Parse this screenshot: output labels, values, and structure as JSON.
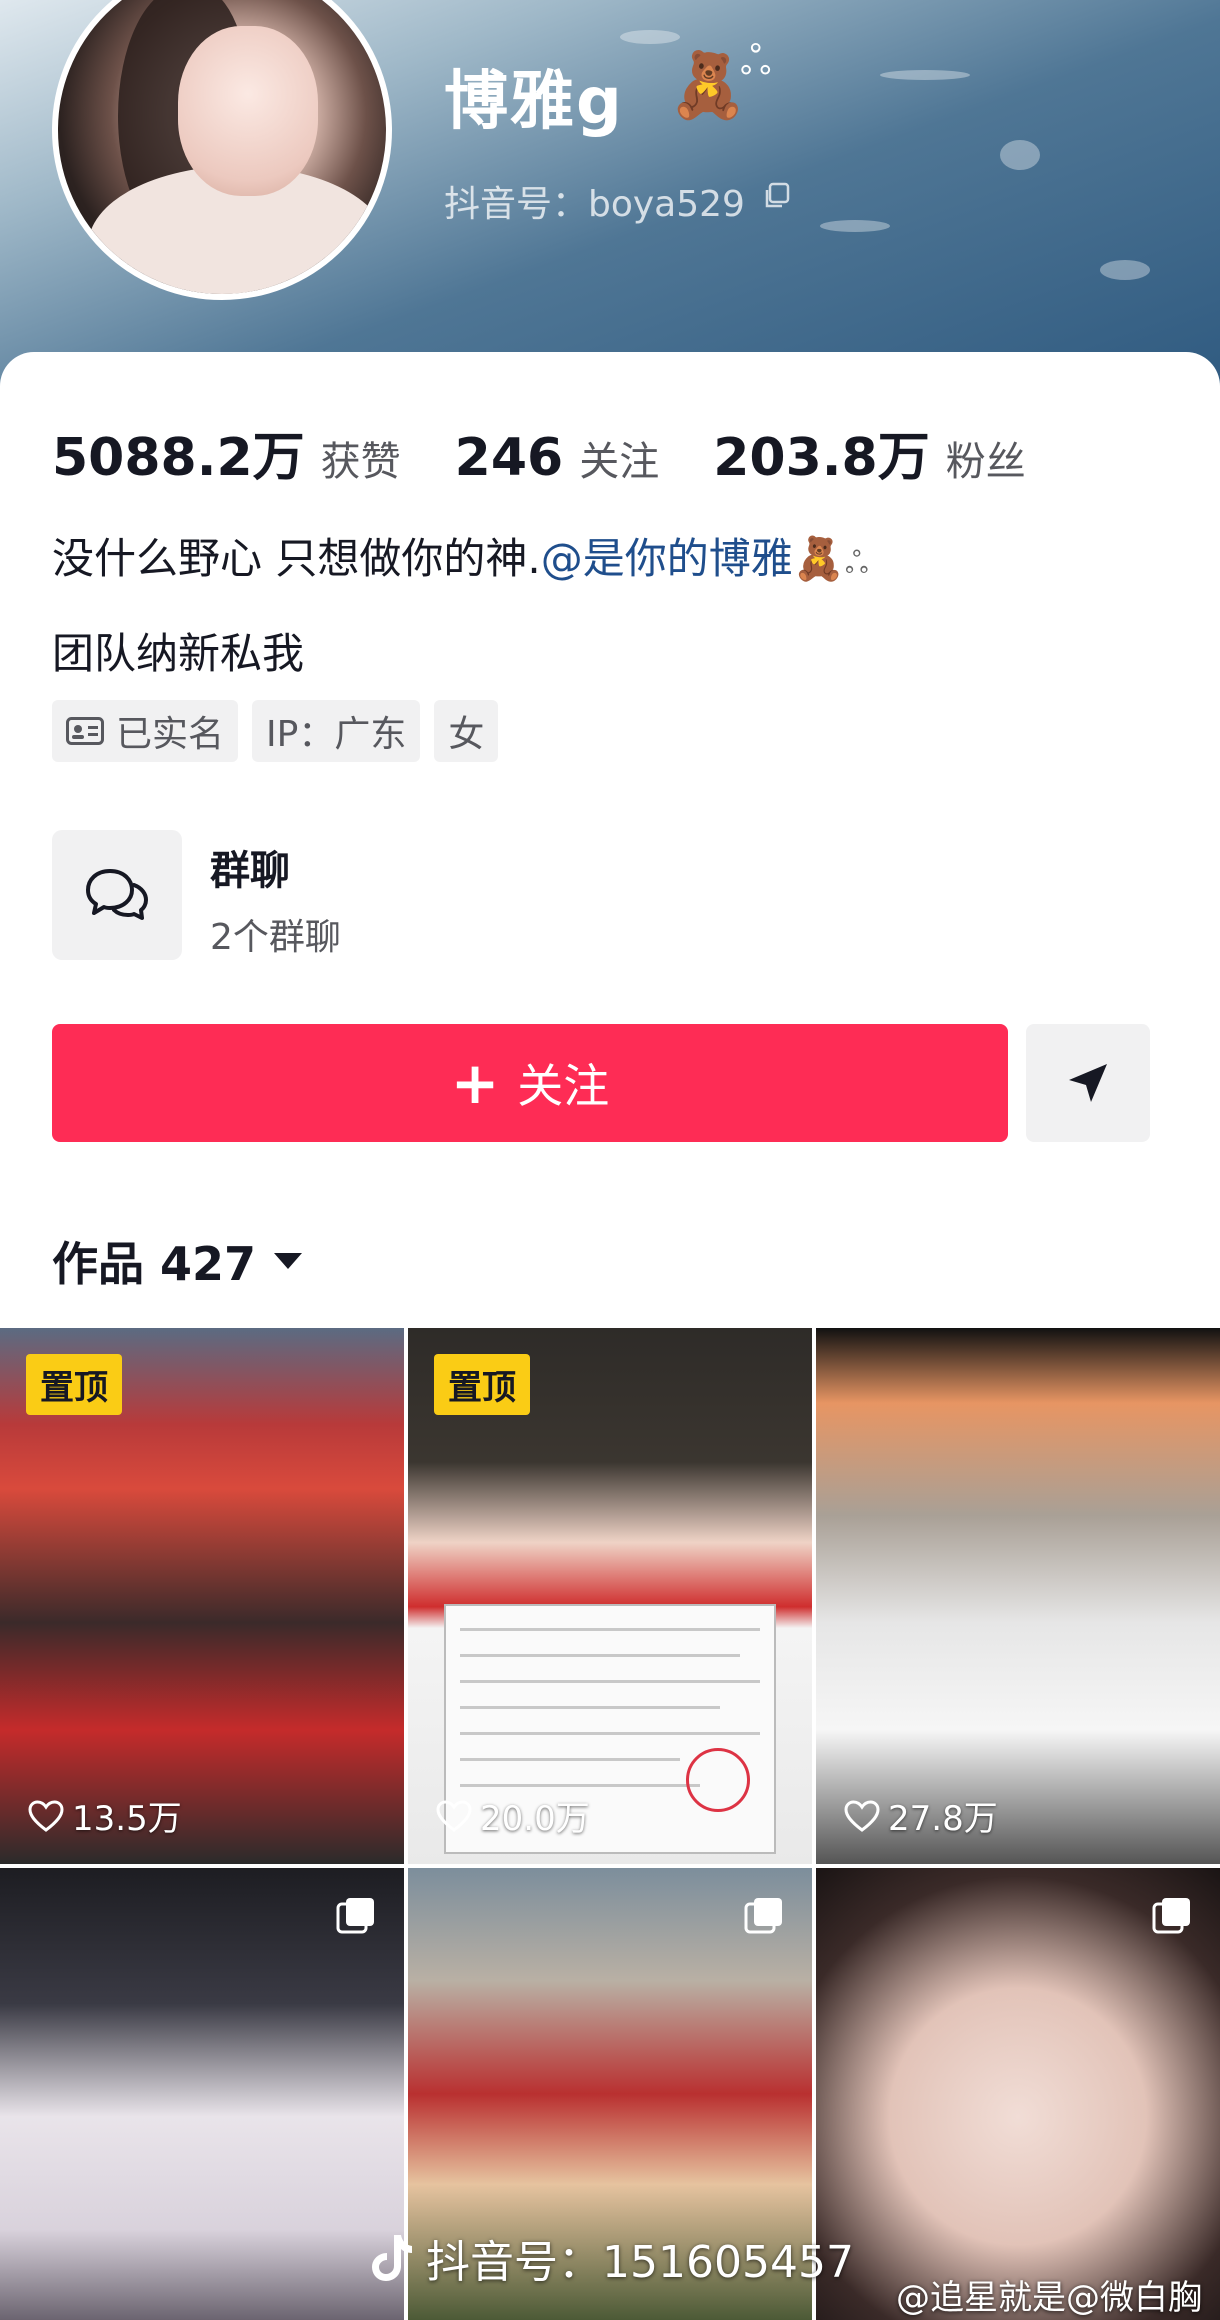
{
  "profile": {
    "name": "博雅g",
    "name_emoji": "🧸",
    "name_sparkle": "ஃ",
    "douyin_id": "抖音号：boya529"
  },
  "stats": [
    {
      "value": "5088.2万",
      "label": "获赞"
    },
    {
      "value": "246",
      "label": "关注"
    },
    {
      "value": "203.8万",
      "label": "粉丝"
    }
  ],
  "bio": {
    "line1_text": "没什么野心 只想做你的神.",
    "line1_mention": "@是你的博雅",
    "line1_emoji": "🧸",
    "line2": "团队纳新私我"
  },
  "tags": {
    "verified": "已实名",
    "ip": "IP：广东",
    "gender": "女"
  },
  "group_chat": {
    "title": "群聊",
    "subtitle": "2个群聊"
  },
  "actions": {
    "follow_label": "关注",
    "follow_plus": "+"
  },
  "works": {
    "label": "作品 427"
  },
  "videos": [
    {
      "pinned": "置顶",
      "likes": "13.5万"
    },
    {
      "pinned": "置顶",
      "likes": "20.0万"
    },
    {
      "likes": "27.8万"
    },
    {},
    {},
    {}
  ],
  "overlay": {
    "watermark": "抖音号：151605457",
    "weibo": "@追星就是@微白胸"
  },
  "colors": {
    "accent": "#fe2c55",
    "mention": "#1f4e8c",
    "pin": "#facc15"
  }
}
